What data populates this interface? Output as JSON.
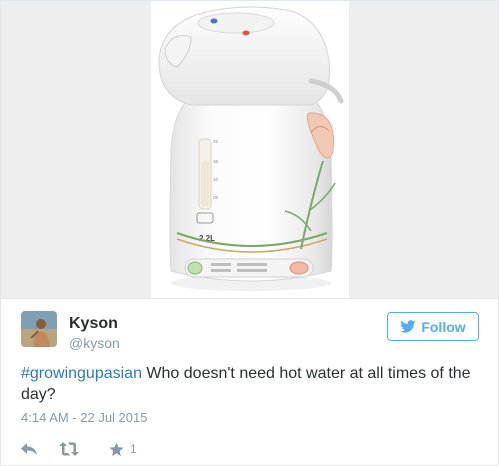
{
  "media": {
    "subject": "hot water dispenser pot",
    "badge_label": "2.2L",
    "scale_marks": [
      "22",
      "15",
      "10",
      "05"
    ]
  },
  "author": {
    "display_name": "Kyson",
    "handle": "@kyson"
  },
  "follow_button": {
    "label": "Follow"
  },
  "tweet": {
    "hashtag": "#growingupasian",
    "text": " Who doesn't need hot water at all times of the day?"
  },
  "timestamp": "4:14 AM - 22 Jul 2015",
  "actions": {
    "favorite_count": "1"
  },
  "colors": {
    "accent": "#55acee",
    "hashtag": "#2b7bb9",
    "meta_gray": "#8899a6"
  },
  "icons": [
    "reply-icon",
    "retweet-icon",
    "star-icon",
    "twitter-bird-icon"
  ]
}
